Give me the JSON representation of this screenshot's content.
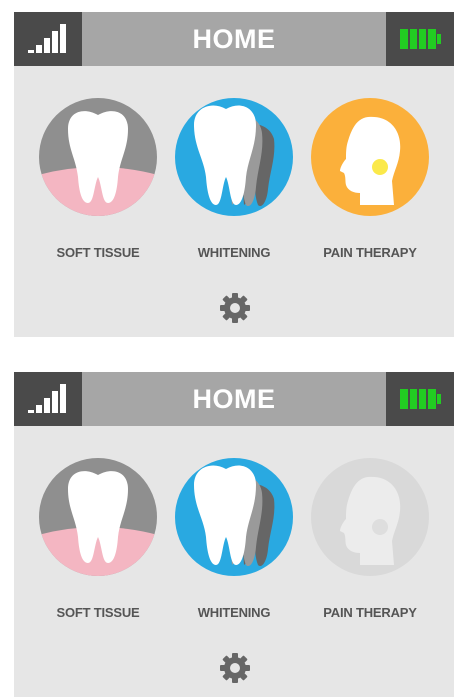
{
  "screens": [
    {
      "state": "pain-therapy-enabled",
      "header": {
        "title": "HOME"
      },
      "modes": [
        {
          "label": "SOFT TISSUE",
          "enabled": true,
          "icon": "tooth-gum-icon"
        },
        {
          "label": "WHITENING",
          "enabled": true,
          "icon": "whitening-teeth-icon"
        },
        {
          "label": "PAIN THERAPY",
          "enabled": true,
          "icon": "head-profile-icon"
        }
      ]
    },
    {
      "state": "pain-therapy-disabled",
      "header": {
        "title": "HOME"
      },
      "modes": [
        {
          "label": "SOFT TISSUE",
          "enabled": true,
          "icon": "tooth-gum-icon"
        },
        {
          "label": "WHITENING",
          "enabled": true,
          "icon": "whitening-teeth-icon"
        },
        {
          "label": "PAIN THERAPY",
          "enabled": false,
          "icon": "head-profile-icon"
        }
      ]
    }
  ],
  "colors": {
    "header_bar": "#a6a6a6",
    "header_dark": "#4a4a4a",
    "battery_green": "#22cc22",
    "whitening_blue": "#29a9e1",
    "pain_orange": "#fbb03b",
    "gum_pink": "#f4b6c2",
    "disabled_gray": "#d9d9d9"
  }
}
